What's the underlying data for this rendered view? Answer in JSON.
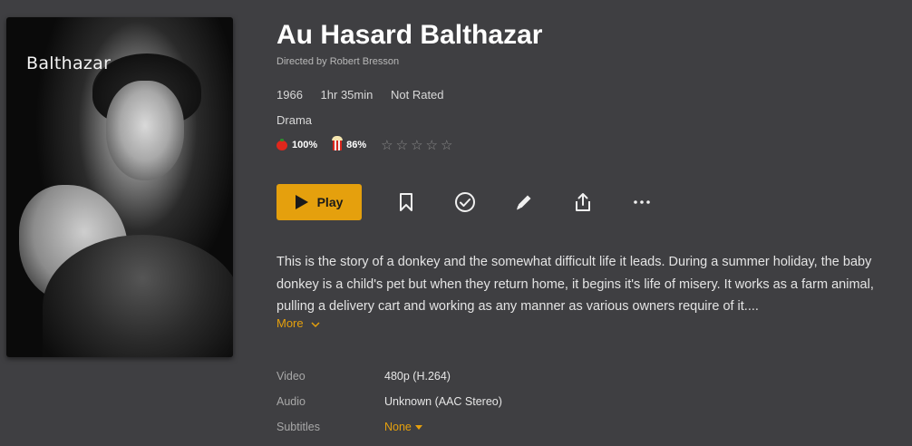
{
  "poster": {
    "title_text": "Balthazar"
  },
  "movie": {
    "title": "Au Hasard Balthazar",
    "director_line": "Directed by Robert Bresson",
    "year": "1966",
    "runtime": "1hr 35min",
    "rating": "Not Rated",
    "genre": "Drama"
  },
  "ratings": {
    "critic_score": "100%",
    "critic_icon": "tomato-icon",
    "audience_score": "86%",
    "audience_icon": "popcorn-icon",
    "user_stars": 0,
    "stars_max": 5
  },
  "actions": {
    "play_label": "Play",
    "icons": [
      "bookmark-icon",
      "check-circle-icon",
      "pencil-icon",
      "share-icon",
      "more-icon"
    ]
  },
  "summary": {
    "text": "This is the story of a donkey and the somewhat difficult life it leads. During a summer holiday, the baby donkey is a child's pet but when they return home, it begins it's life of misery. It works as a farm animal, pulling a delivery cart and working as any manner as various owners require of it....",
    "more_label": "More"
  },
  "media_info": {
    "video_label": "Video",
    "video_value": "480p (H.264)",
    "audio_label": "Audio",
    "audio_value": "Unknown (AAC Stereo)",
    "subtitles_label": "Subtitles",
    "subtitles_value": "None"
  },
  "colors": {
    "accent": "#e5a00d",
    "background": "#3f3f42"
  }
}
